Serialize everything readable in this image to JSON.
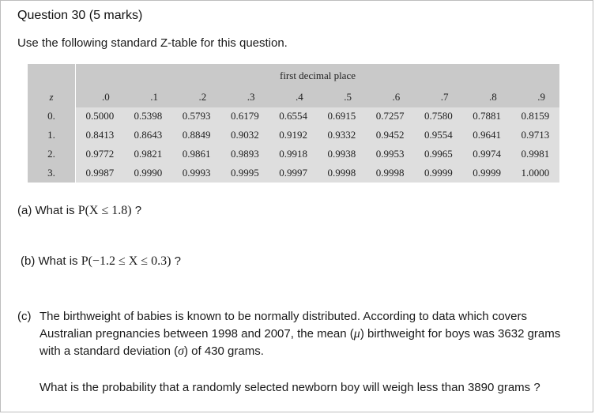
{
  "question": {
    "title": "Question 30",
    "marks": "(5 marks)",
    "intro": "Use the following standard Z-table for this question."
  },
  "ztable": {
    "corner_label": "z",
    "group_header": "first decimal place",
    "columns": [
      ".0",
      ".1",
      ".2",
      ".3",
      ".4",
      ".5",
      ".6",
      ".7",
      ".8",
      ".9"
    ],
    "rows": [
      {
        "z": "0.",
        "values": [
          "0.5000",
          "0.5398",
          "0.5793",
          "0.6179",
          "0.6554",
          "0.6915",
          "0.7257",
          "0.7580",
          "0.7881",
          "0.8159"
        ]
      },
      {
        "z": "1.",
        "values": [
          "0.8413",
          "0.8643",
          "0.8849",
          "0.9032",
          "0.9192",
          "0.9332",
          "0.9452",
          "0.9554",
          "0.9641",
          "0.9713"
        ]
      },
      {
        "z": "2.",
        "values": [
          "0.9772",
          "0.9821",
          "0.9861",
          "0.9893",
          "0.9918",
          "0.9938",
          "0.9953",
          "0.9965",
          "0.9974",
          "0.9981"
        ]
      },
      {
        "z": "3.",
        "values": [
          "0.9987",
          "0.9990",
          "0.9993",
          "0.9995",
          "0.9997",
          "0.9998",
          "0.9998",
          "0.9999",
          "0.9999",
          "1.0000"
        ]
      }
    ]
  },
  "parts": {
    "a": {
      "label": "(a)",
      "prefix": "What is",
      "math": "P(X ≤ 1.8)",
      "suffix": "?"
    },
    "b": {
      "label": "(b)",
      "prefix": "What is",
      "math": "P(−1.2 ≤ X ≤ 0.3)",
      "suffix": "?"
    },
    "c": {
      "label": "(c)",
      "text_1": "The birthweight of babies is known to be normally distributed. According to data which covers Australian pregnancies between 1998 and 2007, the mean (",
      "mu": "μ",
      "text_2": ") birthweight for boys was 3632 grams with a standard deviation (",
      "sigma": "σ",
      "text_3": ") of 430 grams.",
      "question": "What is the probability that a randomly selected newborn boy will weigh less than 3890 grams ?"
    }
  }
}
